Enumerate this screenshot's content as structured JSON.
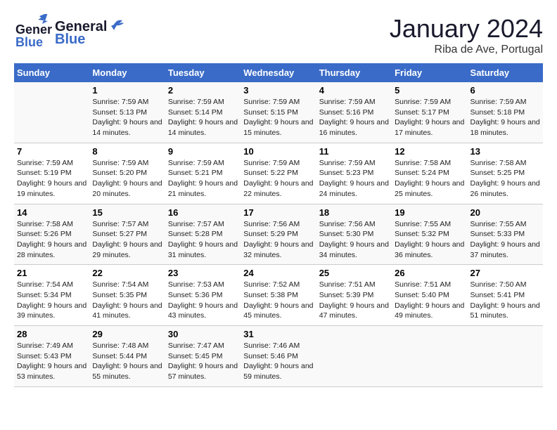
{
  "header": {
    "logo": {
      "part1": "General",
      "part2": "Blue"
    },
    "title": "January 2024",
    "subtitle": "Riba de Ave, Portugal"
  },
  "weekdays": [
    "Sunday",
    "Monday",
    "Tuesday",
    "Wednesday",
    "Thursday",
    "Friday",
    "Saturday"
  ],
  "weeks": [
    [
      {
        "day": null,
        "info": null
      },
      {
        "day": "1",
        "sunrise": "Sunrise: 7:59 AM",
        "sunset": "Sunset: 5:13 PM",
        "daylight": "Daylight: 9 hours and 14 minutes."
      },
      {
        "day": "2",
        "sunrise": "Sunrise: 7:59 AM",
        "sunset": "Sunset: 5:14 PM",
        "daylight": "Daylight: 9 hours and 14 minutes."
      },
      {
        "day": "3",
        "sunrise": "Sunrise: 7:59 AM",
        "sunset": "Sunset: 5:15 PM",
        "daylight": "Daylight: 9 hours and 15 minutes."
      },
      {
        "day": "4",
        "sunrise": "Sunrise: 7:59 AM",
        "sunset": "Sunset: 5:16 PM",
        "daylight": "Daylight: 9 hours and 16 minutes."
      },
      {
        "day": "5",
        "sunrise": "Sunrise: 7:59 AM",
        "sunset": "Sunset: 5:17 PM",
        "daylight": "Daylight: 9 hours and 17 minutes."
      },
      {
        "day": "6",
        "sunrise": "Sunrise: 7:59 AM",
        "sunset": "Sunset: 5:18 PM",
        "daylight": "Daylight: 9 hours and 18 minutes."
      }
    ],
    [
      {
        "day": "7",
        "sunrise": "Sunrise: 7:59 AM",
        "sunset": "Sunset: 5:19 PM",
        "daylight": "Daylight: 9 hours and 19 minutes."
      },
      {
        "day": "8",
        "sunrise": "Sunrise: 7:59 AM",
        "sunset": "Sunset: 5:20 PM",
        "daylight": "Daylight: 9 hours and 20 minutes."
      },
      {
        "day": "9",
        "sunrise": "Sunrise: 7:59 AM",
        "sunset": "Sunset: 5:21 PM",
        "daylight": "Daylight: 9 hours and 21 minutes."
      },
      {
        "day": "10",
        "sunrise": "Sunrise: 7:59 AM",
        "sunset": "Sunset: 5:22 PM",
        "daylight": "Daylight: 9 hours and 22 minutes."
      },
      {
        "day": "11",
        "sunrise": "Sunrise: 7:59 AM",
        "sunset": "Sunset: 5:23 PM",
        "daylight": "Daylight: 9 hours and 24 minutes."
      },
      {
        "day": "12",
        "sunrise": "Sunrise: 7:58 AM",
        "sunset": "Sunset: 5:24 PM",
        "daylight": "Daylight: 9 hours and 25 minutes."
      },
      {
        "day": "13",
        "sunrise": "Sunrise: 7:58 AM",
        "sunset": "Sunset: 5:25 PM",
        "daylight": "Daylight: 9 hours and 26 minutes."
      }
    ],
    [
      {
        "day": "14",
        "sunrise": "Sunrise: 7:58 AM",
        "sunset": "Sunset: 5:26 PM",
        "daylight": "Daylight: 9 hours and 28 minutes."
      },
      {
        "day": "15",
        "sunrise": "Sunrise: 7:57 AM",
        "sunset": "Sunset: 5:27 PM",
        "daylight": "Daylight: 9 hours and 29 minutes."
      },
      {
        "day": "16",
        "sunrise": "Sunrise: 7:57 AM",
        "sunset": "Sunset: 5:28 PM",
        "daylight": "Daylight: 9 hours and 31 minutes."
      },
      {
        "day": "17",
        "sunrise": "Sunrise: 7:56 AM",
        "sunset": "Sunset: 5:29 PM",
        "daylight": "Daylight: 9 hours and 32 minutes."
      },
      {
        "day": "18",
        "sunrise": "Sunrise: 7:56 AM",
        "sunset": "Sunset: 5:30 PM",
        "daylight": "Daylight: 9 hours and 34 minutes."
      },
      {
        "day": "19",
        "sunrise": "Sunrise: 7:55 AM",
        "sunset": "Sunset: 5:32 PM",
        "daylight": "Daylight: 9 hours and 36 minutes."
      },
      {
        "day": "20",
        "sunrise": "Sunrise: 7:55 AM",
        "sunset": "Sunset: 5:33 PM",
        "daylight": "Daylight: 9 hours and 37 minutes."
      }
    ],
    [
      {
        "day": "21",
        "sunrise": "Sunrise: 7:54 AM",
        "sunset": "Sunset: 5:34 PM",
        "daylight": "Daylight: 9 hours and 39 minutes."
      },
      {
        "day": "22",
        "sunrise": "Sunrise: 7:54 AM",
        "sunset": "Sunset: 5:35 PM",
        "daylight": "Daylight: 9 hours and 41 minutes."
      },
      {
        "day": "23",
        "sunrise": "Sunrise: 7:53 AM",
        "sunset": "Sunset: 5:36 PM",
        "daylight": "Daylight: 9 hours and 43 minutes."
      },
      {
        "day": "24",
        "sunrise": "Sunrise: 7:52 AM",
        "sunset": "Sunset: 5:38 PM",
        "daylight": "Daylight: 9 hours and 45 minutes."
      },
      {
        "day": "25",
        "sunrise": "Sunrise: 7:51 AM",
        "sunset": "Sunset: 5:39 PM",
        "daylight": "Daylight: 9 hours and 47 minutes."
      },
      {
        "day": "26",
        "sunrise": "Sunrise: 7:51 AM",
        "sunset": "Sunset: 5:40 PM",
        "daylight": "Daylight: 9 hours and 49 minutes."
      },
      {
        "day": "27",
        "sunrise": "Sunrise: 7:50 AM",
        "sunset": "Sunset: 5:41 PM",
        "daylight": "Daylight: 9 hours and 51 minutes."
      }
    ],
    [
      {
        "day": "28",
        "sunrise": "Sunrise: 7:49 AM",
        "sunset": "Sunset: 5:43 PM",
        "daylight": "Daylight: 9 hours and 53 minutes."
      },
      {
        "day": "29",
        "sunrise": "Sunrise: 7:48 AM",
        "sunset": "Sunset: 5:44 PM",
        "daylight": "Daylight: 9 hours and 55 minutes."
      },
      {
        "day": "30",
        "sunrise": "Sunrise: 7:47 AM",
        "sunset": "Sunset: 5:45 PM",
        "daylight": "Daylight: 9 hours and 57 minutes."
      },
      {
        "day": "31",
        "sunrise": "Sunrise: 7:46 AM",
        "sunset": "Sunset: 5:46 PM",
        "daylight": "Daylight: 9 hours and 59 minutes."
      },
      {
        "day": null,
        "info": null
      },
      {
        "day": null,
        "info": null
      },
      {
        "day": null,
        "info": null
      }
    ]
  ]
}
